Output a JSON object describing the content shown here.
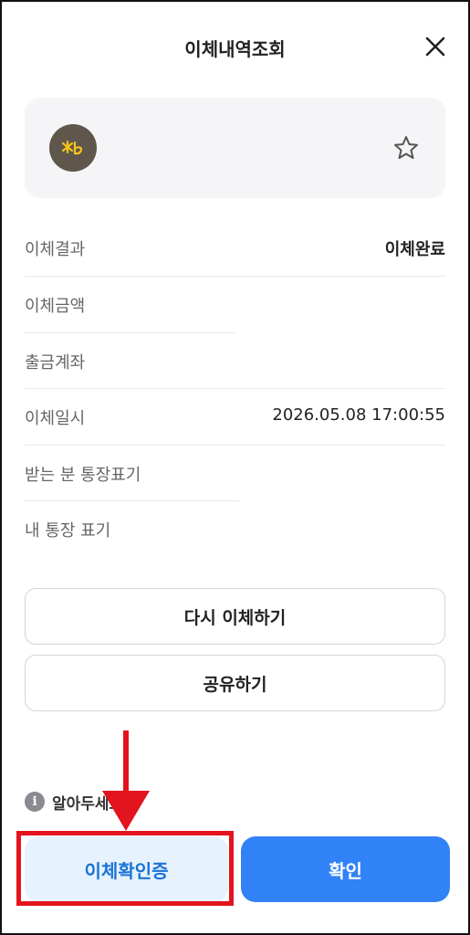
{
  "header": {
    "title": "이체내역조회",
    "close_icon": "close-icon"
  },
  "account_card": {
    "logo_text": "✱b",
    "logo_icon": "kb-bank-logo",
    "favorite_icon": "star-outline-icon"
  },
  "details": [
    {
      "label": "이체결과",
      "value": "이체완료"
    },
    {
      "label": "이체금액",
      "value": ""
    },
    {
      "label": "출금계좌",
      "value": ""
    },
    {
      "label": "이체일시",
      "value": "2026.05.08 17:00:55"
    },
    {
      "label": "받는 분 통장표기",
      "value": ""
    },
    {
      "label": "내 통장 표기",
      "value": ""
    }
  ],
  "actions": {
    "retry_label": "다시 이체하기",
    "share_label": "공유하기"
  },
  "notice": {
    "icon": "info-icon",
    "icon_glyph": "i",
    "text": "알아두세요"
  },
  "footer": {
    "verify_label": "이체확인증",
    "confirm_label": "확인"
  },
  "colors": {
    "primary": "#3182f6",
    "primary_light": "#e6f2fd",
    "annotation_red": "#e3141e",
    "logo_bg": "#5f564c",
    "logo_fg": "#f5c518"
  }
}
